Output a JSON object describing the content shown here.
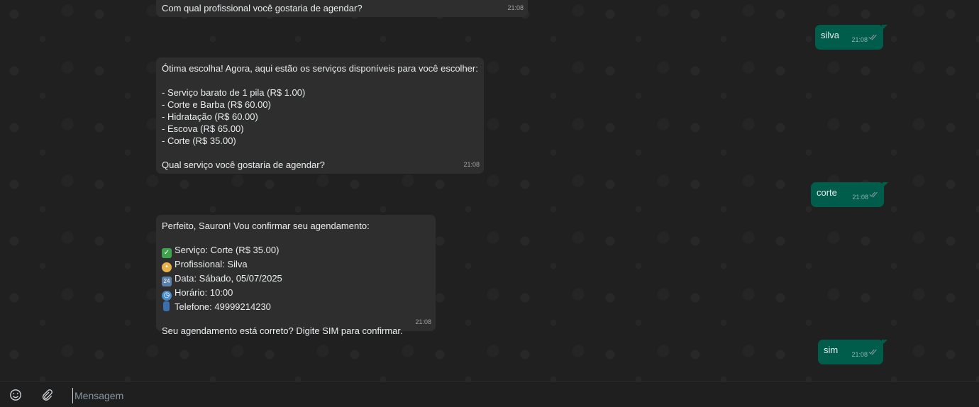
{
  "messages": {
    "m1": {
      "text": "Com qual profissional você gostaria de agendar?",
      "time": "21:08"
    },
    "m2": {
      "text": "silva",
      "time": "21:08"
    },
    "m3": {
      "text": "Ótima escolha! Agora, aqui estão os serviços disponíveis para você escolher:\n\n- Serviço barato de 1 pila (R$ 1.00)\n- Corte e Barba (R$ 60.00)\n- Hidratação (R$ 60.00)\n- Escova (R$ 65.00)\n- Corte (R$ 35.00)\n\nQual serviço você gostaria de agendar?",
      "time": "21:08"
    },
    "m4": {
      "text": "corte",
      "time": "21:08"
    },
    "m5": {
      "intro": "Perfeito, Sauron! Vou confirmar seu agendamento:",
      "lines": [
        {
          "icon": "check-mark-icon",
          "text": "Serviço: Corte (R$ 35.00)"
        },
        {
          "icon": "person-icon",
          "text": "Profissional: Silva"
        },
        {
          "icon": "calendar-icon",
          "text": "Data: Sábado, 05/07/2025"
        },
        {
          "icon": "alarm-clock-icon",
          "text": "Horário: 10:00"
        },
        {
          "icon": "mobile-phone-icon",
          "text": "Telefone: 49999214230"
        }
      ],
      "outro": "Seu agendamento está correto? Digite SIM para confirmar.",
      "time": "21:08"
    },
    "m6": {
      "text": "sim",
      "time": "21:08"
    }
  },
  "composer": {
    "placeholder": "Mensagem"
  },
  "colors": {
    "incoming_bubble": "#2e2e2e",
    "outgoing_bubble": "#005c4b",
    "tick_read": "#8696a0"
  }
}
